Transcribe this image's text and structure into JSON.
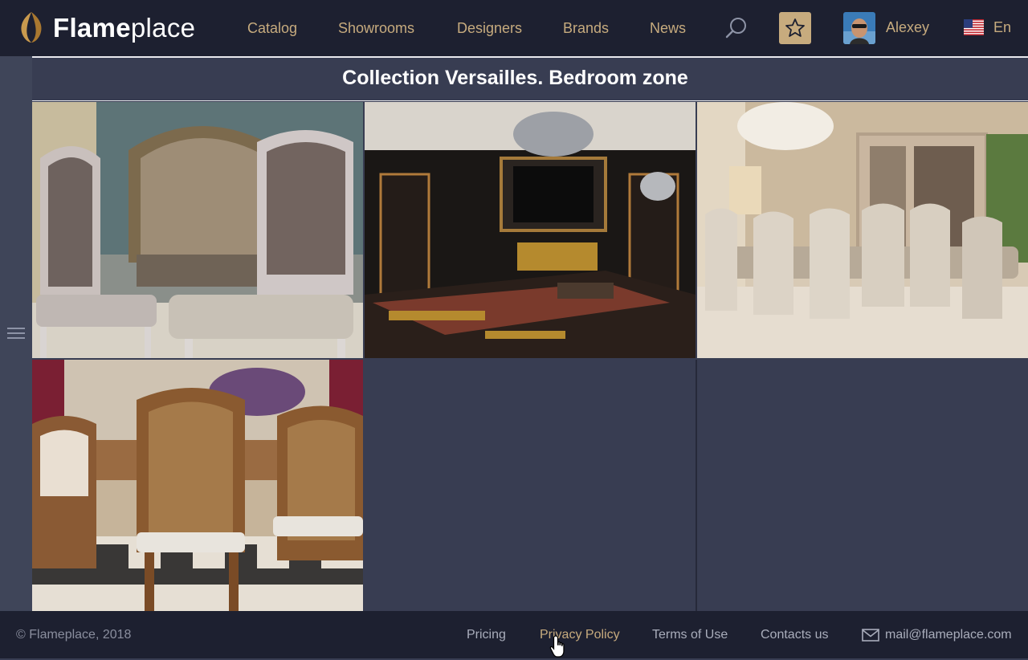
{
  "header": {
    "logo_bold": "Flame",
    "logo_light": "place",
    "nav": [
      "Catalog",
      "Showrooms",
      "Designers",
      "Brands",
      "News"
    ],
    "icons": {
      "search": "search-icon",
      "favorites": "star-icon"
    },
    "user_name": "Alexey",
    "language": "En",
    "accent_color": "#c7ab7e"
  },
  "page": {
    "title": "Collection Versailles. Bedroom zone",
    "gallery": [
      {
        "name": "photo-ornate-chairs-and-sofa"
      },
      {
        "name": "photo-dark-wood-office-with-chandelier"
      },
      {
        "name": "photo-dining-room-with-display-cabinet"
      },
      {
        "name": "photo-carved-wooden-dining-chairs"
      }
    ]
  },
  "footer": {
    "copyright": "© Flameplace, 2018",
    "links": [
      "Pricing",
      "Privacy Policy",
      "Terms of Use",
      "Contacts us"
    ],
    "email": "mail@flameplace.com"
  }
}
